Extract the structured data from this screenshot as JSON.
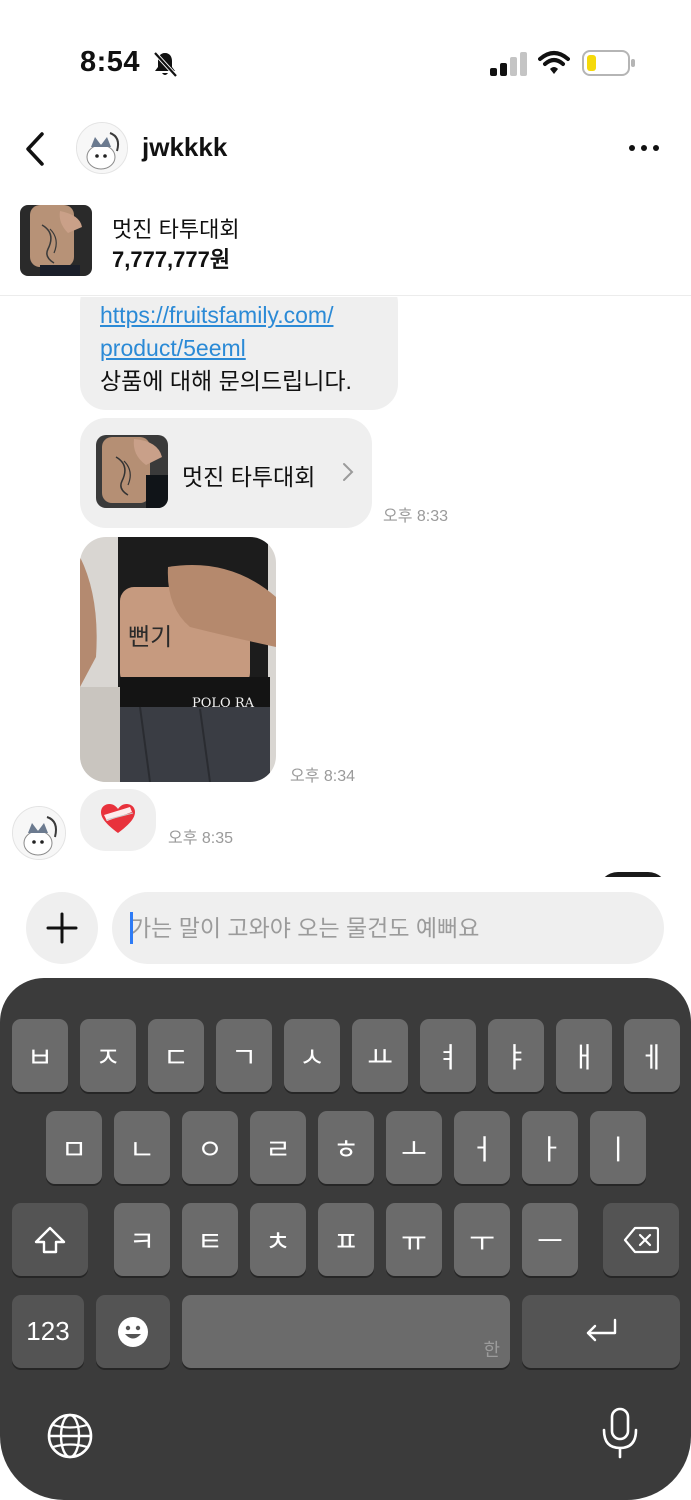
{
  "status_bar": {
    "time": "8:54"
  },
  "header": {
    "username": "jwkkkk"
  },
  "product": {
    "name": "멋진 타투대회",
    "price": "7,777,777원"
  },
  "messages": {
    "link_line1": "https://fruitsfamily.com/",
    "link_line2": "product/5eeml",
    "inquiry_text": "상품에 대해 문의드립니다.",
    "product_card_name": "멋진 타투대회",
    "time_product": "오후 8:33",
    "time_photo": "오후 8:34",
    "time_heart": "오후 8:35",
    "heart": "heart-emoji"
  },
  "input": {
    "placeholder": "가는 말이 고와야 오는 물건도 예뻐요"
  },
  "keyboard": {
    "row1": [
      "ㅂ",
      "ㅈ",
      "ㄷ",
      "ㄱ",
      "ㅅ",
      "ㅛ",
      "ㅕ",
      "ㅑ",
      "ㅐ",
      "ㅔ"
    ],
    "row2": [
      "ㅁ",
      "ㄴ",
      "ㅇ",
      "ㄹ",
      "ㅎ",
      "ㅗ",
      "ㅓ",
      "ㅏ",
      "ㅣ"
    ],
    "row3": [
      "ㅋ",
      "ㅌ",
      "ㅊ",
      "ㅍ",
      "ㅠ",
      "ㅜ",
      "ㅡ"
    ],
    "numbers_key": "123",
    "space_sub": "한"
  },
  "colors": {
    "link": "#2b8ad6",
    "bubble": "#efefef",
    "keyboard_bg": "#3b3b3b",
    "key": "#6b6b6b",
    "battery_level": "#f5d90a"
  }
}
